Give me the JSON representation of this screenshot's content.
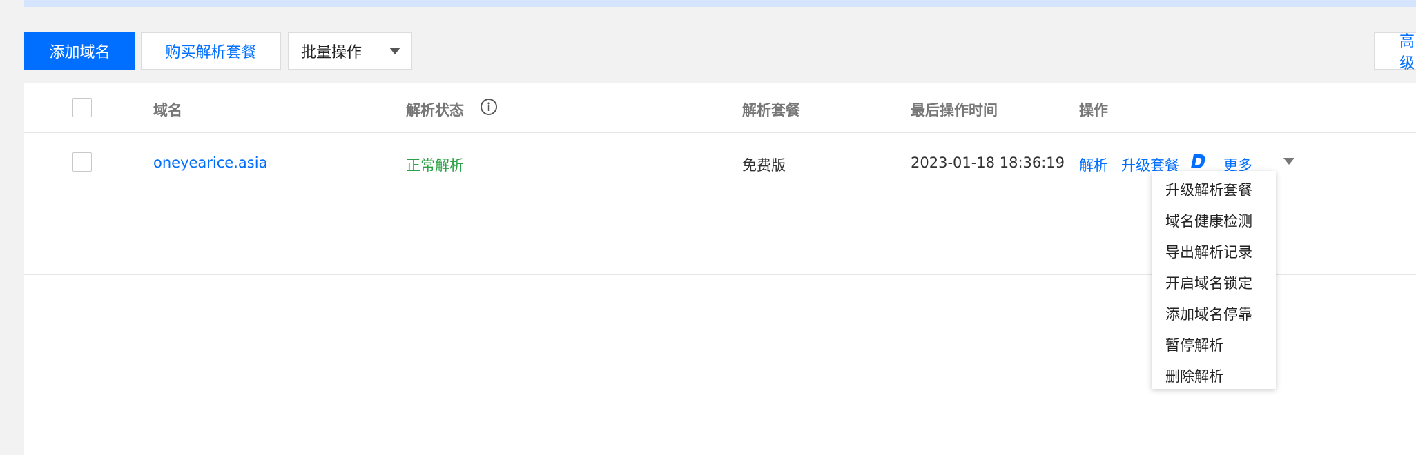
{
  "toolbar": {
    "add_domain": "添加域名",
    "buy_package": "购买解析套餐",
    "batch_operation": "批量操作",
    "advanced": "高级"
  },
  "table": {
    "headers": {
      "domain": "域名",
      "status": "解析状态",
      "package": "解析套餐",
      "last_time": "最后操作时间",
      "actions": "操作"
    },
    "rows": [
      {
        "domain": "oneyearice.asia",
        "status": "正常解析",
        "package": "免费版",
        "last_time": "2023-01-18 18:36:19",
        "action_resolve": "解析",
        "action_upgrade": "升级套餐",
        "action_more": "更多"
      }
    ]
  },
  "more_menu": {
    "items": [
      "升级解析套餐",
      "域名健康检测",
      "导出解析记录",
      "开启域名锁定",
      "添加域名停靠",
      "暂停解析",
      "删除解析"
    ]
  },
  "colors": {
    "primary": "#006eff",
    "status_ok": "#2ba245",
    "banner": "#d5e5ff"
  },
  "icons": {
    "status_info": "info-circle-icon",
    "upgrade_badge": "dnspod-d-icon",
    "dropdown": "caret-down-icon"
  }
}
